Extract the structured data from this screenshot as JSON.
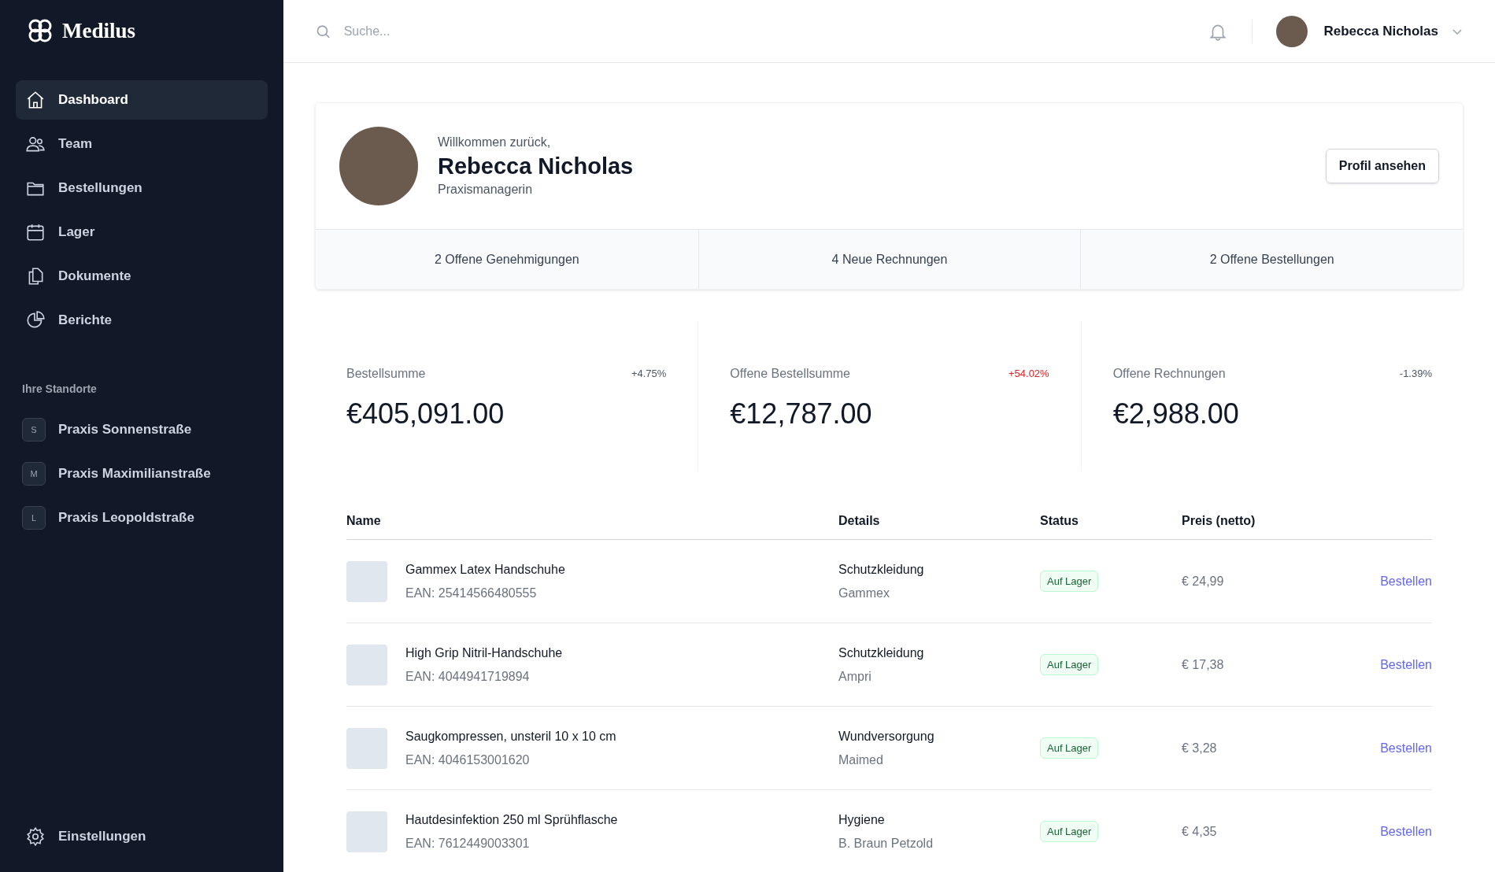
{
  "brand": {
    "name": "Medilus"
  },
  "nav": [
    {
      "label": "Dashboard",
      "selected": true
    },
    {
      "label": "Team",
      "selected": false
    },
    {
      "label": "Bestellungen",
      "selected": false
    },
    {
      "label": "Lager",
      "selected": false
    },
    {
      "label": "Dokumente",
      "selected": false
    },
    {
      "label": "Berichte",
      "selected": false
    }
  ],
  "locations": {
    "heading": "Ihre Standorte",
    "items": [
      {
        "initial": "S",
        "label": "Praxis Sonnenstraße"
      },
      {
        "initial": "M",
        "label": "Praxis Maximilianstraße"
      },
      {
        "initial": "L",
        "label": "Praxis Leopoldstraße"
      }
    ]
  },
  "settings": {
    "label": "Einstellungen"
  },
  "search": {
    "placeholder": "Suche..."
  },
  "user": {
    "name": "Rebecca Nicholas"
  },
  "welcome": {
    "greeting": "Willkommen zurück,",
    "name": "Rebecca Nicholas",
    "role": "Praxismanagerin",
    "button": "Profil ansehen"
  },
  "summary": [
    "2 Offene Genehmigungen",
    "4 Neue Rechnungen",
    "2 Offene Bestellungen"
  ],
  "stats": [
    {
      "label": "Bestellsumme",
      "change": "+4.75%",
      "color": "#4b5563",
      "value": "€405,091.00"
    },
    {
      "label": "Offene Bestellsumme",
      "change": "+54.02%",
      "color": "#dc2626",
      "value": "€12,787.00"
    },
    {
      "label": "Offene Rechnungen",
      "change": "-1.39%",
      "color": "#4b5563",
      "value": "€2,988.00"
    }
  ],
  "table": {
    "columns": [
      "Name",
      "Details",
      "Status",
      "Preis (netto)"
    ],
    "rows": [
      {
        "name": "Gammex Latex Handschuhe",
        "ean": "EAN: 25414566480555",
        "category": "Schutzkleidung",
        "brand": "Gammex",
        "status": "Auf Lager",
        "price": "€ 24,99",
        "action": "Bestellen"
      },
      {
        "name": "High Grip Nitril-Handschuhe",
        "ean": "EAN: 4044941719894",
        "category": "Schutzkleidung",
        "brand": "Ampri",
        "status": "Auf Lager",
        "price": "€ 17,38",
        "action": "Bestellen"
      },
      {
        "name": "Saugkompressen, unsteril 10 x 10 cm",
        "ean": "EAN: 4046153001620",
        "category": "Wundversorgung",
        "brand": "Maimed",
        "status": "Auf Lager",
        "price": "€ 3,28",
        "action": "Bestellen"
      },
      {
        "name": "Hautdesinfektion 250 ml Sprühflasche",
        "ean": "EAN: 7612449003301",
        "category": "Hygiene",
        "brand": "B. Braun Petzold",
        "status": "Auf Lager",
        "price": "€ 4,35",
        "action": "Bestellen"
      }
    ]
  }
}
